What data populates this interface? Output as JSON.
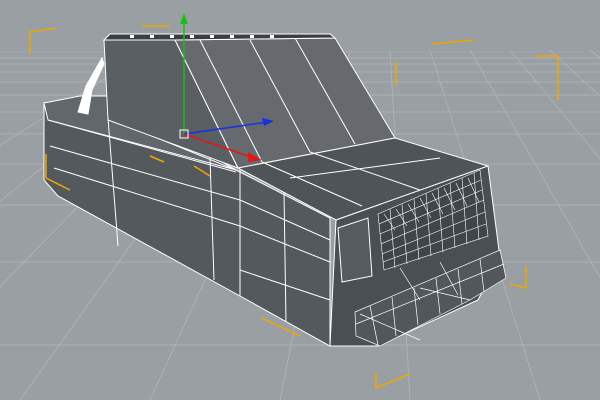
{
  "viewport": {
    "kind": "3d-perspective-viewport",
    "colors": {
      "background": "#9a9fa3",
      "grid_line": "#b6babe",
      "model_face_light": "#5c6165",
      "model_face_dark": "#484c50",
      "wireframe": "#ffffff",
      "selection_bracket": "#f2a500",
      "axis_x": "#e01818",
      "axis_y": "#18c018",
      "axis_z": "#1830e0"
    },
    "icons": {
      "grid": "ground-grid",
      "model": "car-body-mesh",
      "gizmo": "move-axis-gizmo",
      "brackets": "selection-bounding-box-corners"
    }
  }
}
